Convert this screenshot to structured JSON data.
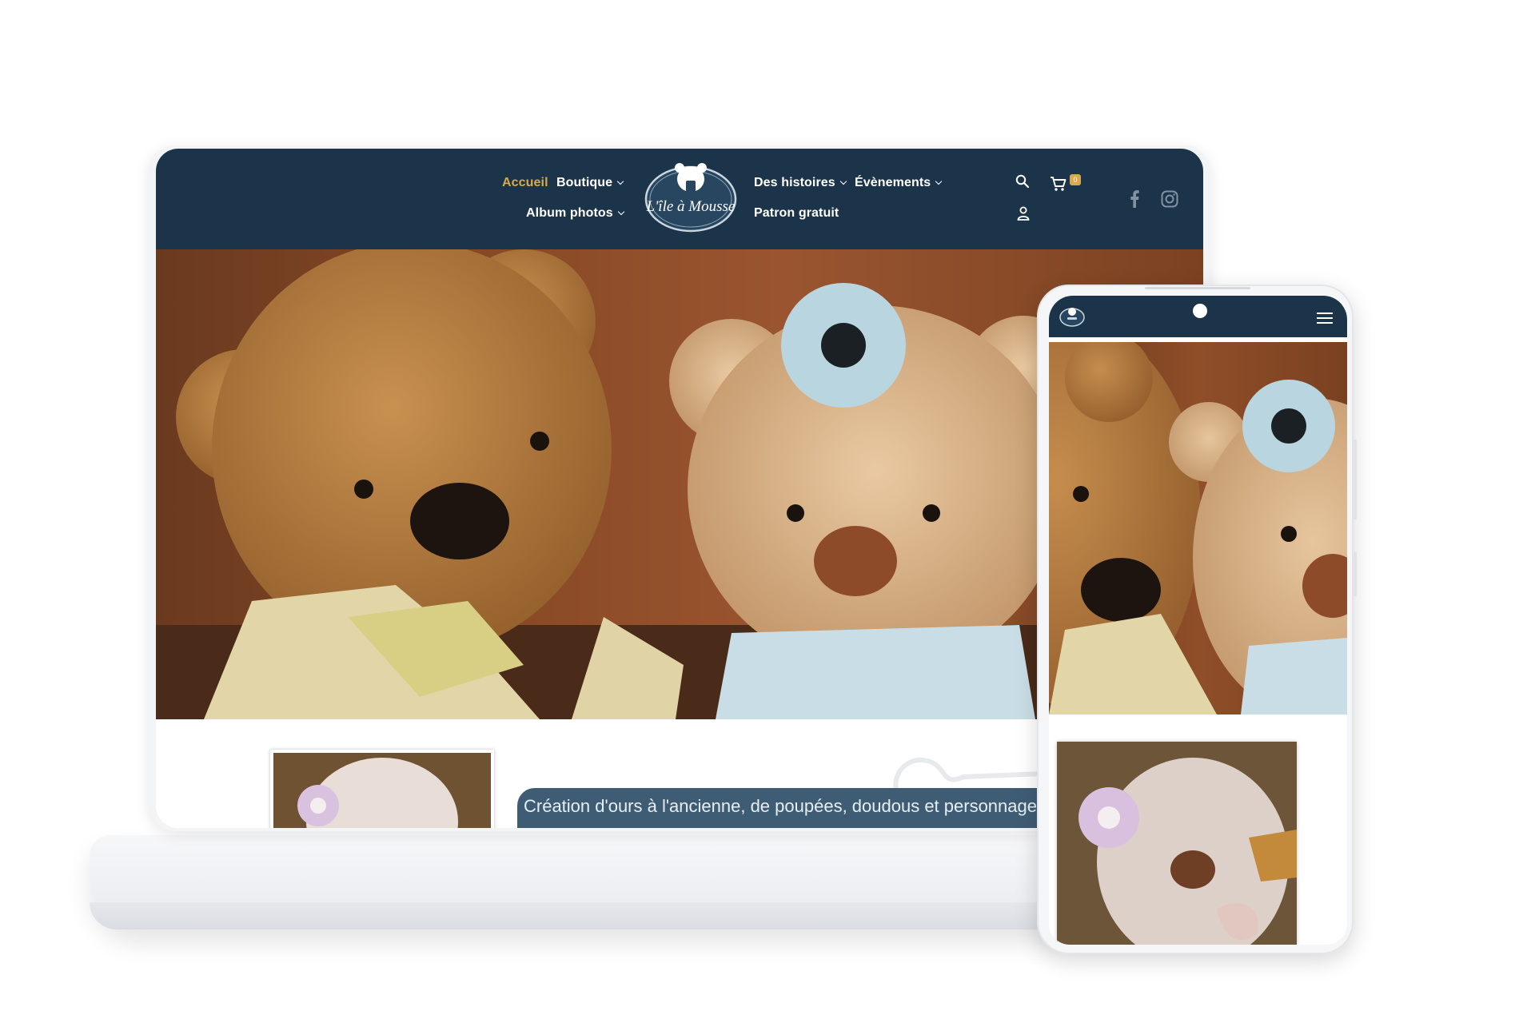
{
  "site": {
    "logo_text": "L'île à Mousse",
    "accent_color": "#d9a94e",
    "header_color": "#1c3449"
  },
  "nav": {
    "home": "Accueil",
    "shop": "Boutique",
    "albums": "Album photos",
    "stories": "Des histoires",
    "events": "Évènements",
    "free_pattern": "Patron gratuit"
  },
  "header_icons": {
    "search": "search-icon",
    "cart": "cart-icon",
    "cart_count": "0",
    "account": "user-icon",
    "facebook": "facebook-icon",
    "instagram": "instagram-icon"
  },
  "main": {
    "tagline": "Création d'ours à l'ancienne, de poupées, doudous et personnages en fe"
  },
  "mobile": {
    "menu_icon": "hamburger-menu-icon"
  }
}
